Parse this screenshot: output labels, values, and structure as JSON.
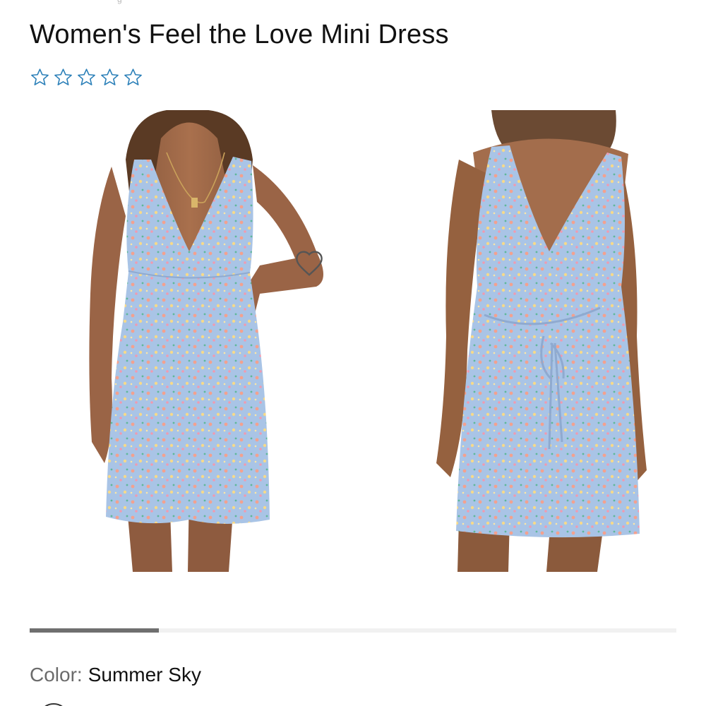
{
  "product": {
    "title": "Women's Feel the Love Mini Dress",
    "rating": {
      "filled": 0,
      "max": 5,
      "star_color": "#2a7fb8",
      "icon": "star-outline-icon"
    },
    "wishlist_icon": "heart-outline-icon"
  },
  "gallery": {
    "images": [
      {
        "view": "front",
        "alt": "Model wearing the dress, front view"
      },
      {
        "view": "back",
        "alt": "Model wearing the dress, back view with tie"
      }
    ],
    "progress": 0.2,
    "colors": {
      "dress": "#a9c4e6",
      "progress_fill": "#6f6f6f",
      "progress_track": "#f1f1f1"
    }
  },
  "color_selector": {
    "label": "Color:",
    "value": "Summer Sky"
  }
}
